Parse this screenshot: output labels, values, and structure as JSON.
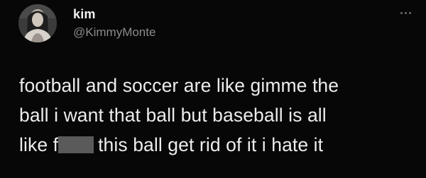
{
  "author": {
    "name": "kim",
    "handle": "@KimmyMonte"
  },
  "tweet": {
    "line1": "football and soccer are like gimme the",
    "line2": "ball i want that ball but baseball is all",
    "line3_prefix": "like f",
    "line3_suffix": "this ball get rid of it i hate it"
  },
  "icons": {
    "more": "more-horizontal-icon",
    "avatar": "profile-photo"
  }
}
